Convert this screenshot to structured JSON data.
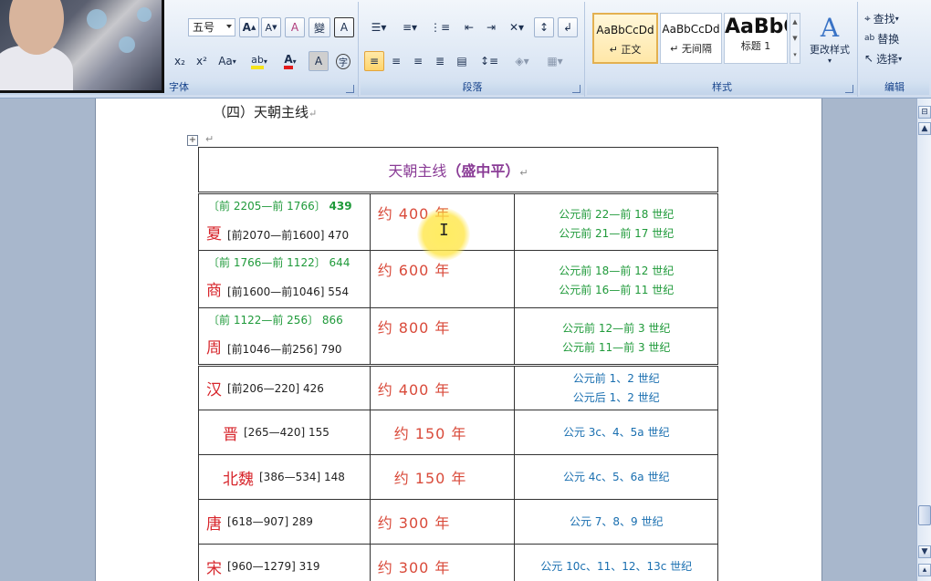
{
  "ribbon": {
    "font_group": {
      "label": "字体",
      "font_size": "五号",
      "grow_font": "A",
      "shrink_font": "A",
      "clear_format": "A",
      "phonetic": "變",
      "border_char": "A",
      "subscript": "x₂",
      "superscript": "x²",
      "change_case": "Aa",
      "highlight": "ab",
      "font_color": "A",
      "char_shading": "A",
      "enclose": "字"
    },
    "paragraph_group": {
      "label": "段落"
    },
    "styles_group": {
      "label": "样式",
      "styles": [
        {
          "sample": "AaBbCcDd",
          "name": "↵ 正文"
        },
        {
          "sample": "AaBbCcDd",
          "name": "↵ 无间隔"
        },
        {
          "sample": "AaBbC",
          "name": "标题 1"
        }
      ],
      "change_styles": "更改样式"
    },
    "editing_group": {
      "label": "编辑",
      "find": "查找",
      "replace": "替换",
      "select": "选择"
    }
  },
  "document": {
    "heading": "（四）天朝主线",
    "para_mark": "↵",
    "table": {
      "title_main": "天朝主线",
      "title_sub": "（盛中平）",
      "rows": [
        {
          "range": "〔前 2205—前 1766〕",
          "range_len": "439",
          "name": "夏",
          "dates": "[前2070—前1600] 470",
          "years": "约 400 年",
          "century": [
            "公元前 22—前 18 世纪",
            "公元前 21—前 17 世纪"
          ]
        },
        {
          "range": "〔前 1766—前 1122〕",
          "range_len": "644",
          "name": "商",
          "dates": "[前1600—前1046] 554",
          "years": "约 600 年",
          "century": [
            "公元前 18—前 12 世纪",
            "公元前 16—前 11 世纪"
          ]
        },
        {
          "range": "〔前 1122—前 256〕",
          "range_len": "866",
          "name": "周",
          "dates": "[前1046—前256] 790",
          "years": "约 800 年",
          "century": [
            "公元前 12—前 3 世纪",
            "公元前 11—前 3 世纪"
          ]
        },
        {
          "name": "汉",
          "dates": "[前206—220] 426",
          "years": "约 400 年",
          "century": [
            "公元前 1、2 世纪",
            "公元后 1、2 世纪"
          ]
        },
        {
          "name": "晋",
          "dates": "[265—420] 155",
          "years": "约 150 年",
          "century": [
            "公元 3c、4、5a 世纪"
          ]
        },
        {
          "name": "北魏",
          "dates": "[386—534] 148",
          "years": "约 150 年",
          "century": [
            "公元 4c、5、6a 世纪"
          ]
        },
        {
          "name": "唐",
          "dates": "[618—907] 289",
          "years": "约 300 年",
          "century": [
            "公元 7、8、9 世纪"
          ]
        },
        {
          "name": "宋",
          "dates": "[960—1279] 319",
          "years": "约 300 年",
          "century": [
            "公元 10c、11、12、13c 世纪"
          ]
        }
      ]
    }
  },
  "colors": {
    "title": "#8a3c96",
    "dynasty_name": "#d7262c",
    "years": "#d94a3a",
    "green": "#1f9a3a",
    "blue": "#1a6fb0"
  }
}
